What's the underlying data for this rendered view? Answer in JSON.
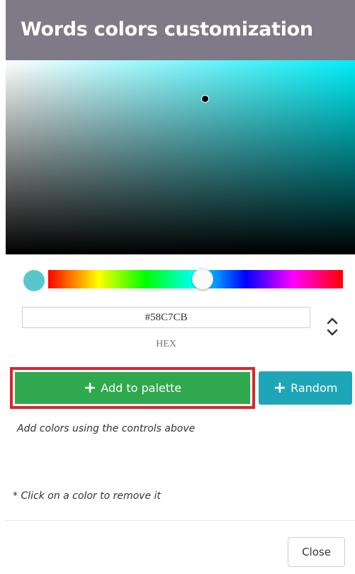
{
  "dialog": {
    "title": "Words colors customization"
  },
  "picker": {
    "current_color": "#58C7CB",
    "hue_color": "#00eef8",
    "hex_value": "#58C7CB",
    "mode_label": "HEX"
  },
  "buttons": {
    "add_label": "Add to palette",
    "random_label": "Random",
    "close_label": "Close"
  },
  "palette": {
    "empty_hint": "Add colors using the controls above",
    "remove_note": "* Click on a color to remove it"
  },
  "colors": {
    "header_bg": "#7e7a88",
    "add_button": "#2fa84e",
    "random_button": "#1ea6b8",
    "highlight_border": "#d9262f"
  }
}
